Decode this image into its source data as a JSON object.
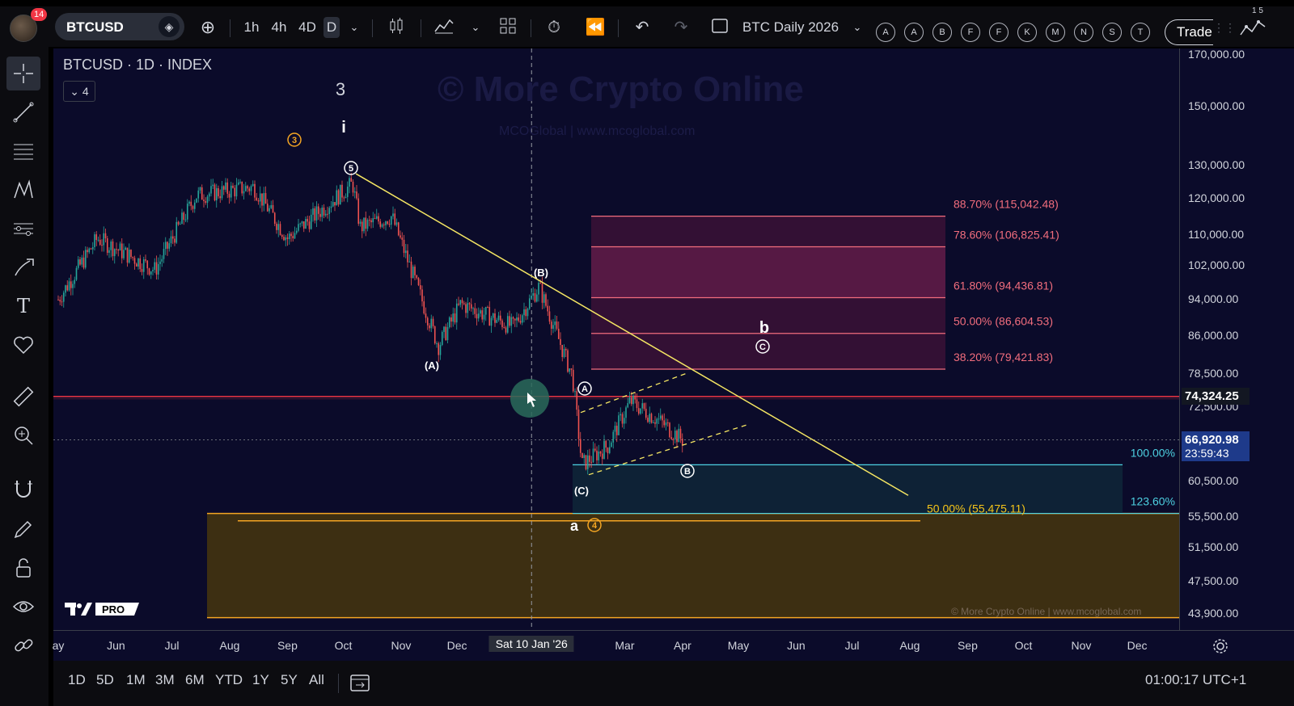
{
  "toolbar": {
    "notification_count": "14",
    "symbol": "BTCUSD",
    "intervals": [
      "1h",
      "4h",
      "4D",
      "D"
    ],
    "active_interval": "D",
    "layout_name": "BTC Daily 2026",
    "alert_letters": [
      "A",
      "A",
      "B",
      "F",
      "F",
      "K",
      "M",
      "N",
      "S",
      "T"
    ],
    "trade_label": "Trade",
    "right_digits": "1 5"
  },
  "chart_header": {
    "legend": "BTCUSD · 1D · INDEX",
    "collapse_count": "4",
    "watermark_main": "© More Crypto Online",
    "watermark_sub": "MCOGlobal  |  www.mcoglobal.com",
    "footer_watermark": "© More Crypto Online  |  www.mcoglobal.com"
  },
  "price_axis": {
    "ticks": [
      "170,000.00",
      "150,000.00",
      "130,000.00",
      "120,000.00",
      "110,000.00",
      "102,000.00",
      "94,000.00",
      "86,000.00",
      "78,500.00",
      "72,500.00",
      "60,500.00",
      "55,500.00",
      "51,500.00",
      "47,500.00",
      "43,900.00"
    ],
    "horizontal_line_price": "74,324.25",
    "last_price": "66,920.98",
    "countdown": "23:59:43"
  },
  "time_axis": {
    "labels": [
      "ay",
      "Jun",
      "Jul",
      "Aug",
      "Sep",
      "Oct",
      "Nov",
      "Dec",
      "Sat 10 Jan '26",
      "Mar",
      "Apr",
      "May",
      "Jun",
      "Jul",
      "Aug",
      "Sep",
      "Oct",
      "Nov",
      "Dec"
    ]
  },
  "bottom_bar": {
    "ranges": [
      "1D",
      "5D",
      "1M",
      "3M",
      "6M",
      "YTD",
      "1Y",
      "5Y",
      "All"
    ],
    "clock": "01:00:17 UTC+1"
  },
  "chart_data": {
    "type": "candlestick",
    "symbol": "BTCUSD",
    "timeframe": "1D",
    "scale": "log",
    "y_ticks": [
      170000,
      150000,
      130000,
      120000,
      110000,
      102000,
      94000,
      86000,
      78500,
      72500,
      60500,
      55500,
      51500,
      47500,
      43900
    ],
    "price_path": {
      "dates": [
        "2025-05-01",
        "2025-05-22",
        "2025-06-22",
        "2025-07-14",
        "2025-08-14",
        "2025-09-01",
        "2025-10-06",
        "2025-10-10",
        "2025-10-27",
        "2025-11-21",
        "2025-12-03",
        "2025-12-31",
        "2026-01-14",
        "2026-02-01",
        "2026-02-06",
        "2026-02-20",
        "2026-03-04",
        "2026-03-20",
        "2026-04-01"
      ],
      "close": [
        94000,
        109000,
        101000,
        121000,
        123500,
        109000,
        124500,
        112000,
        115000,
        84000,
        93000,
        88000,
        97000,
        78000,
        63000,
        66000,
        73500,
        70000,
        66920
      ]
    },
    "fibonacci_retracement": [
      {
        "level": "88.70% (115,042.48)",
        "price": 115042.48
      },
      {
        "level": "78.60% (106,825.41)",
        "price": 106825.41
      },
      {
        "level": "61.80% (94,436.81)",
        "price": 94436.81
      },
      {
        "level": "50.00% (86,604.53)",
        "price": 86604.53
      },
      {
        "level": "38.20% (79,421.83)",
        "price": 79421.83
      }
    ],
    "fibonacci_extension": [
      {
        "level": "100.00%",
        "price": 63000
      },
      {
        "level": "123.60%",
        "price": 56000
      }
    ],
    "support_label": "50.00% (55,475.11)",
    "support_price": 55475.11,
    "support_zone": [
      56000,
      43500
    ],
    "horizontal_line": 74324.25,
    "last_price": 66920.98,
    "wave_labels": [
      "3",
      "i",
      "3",
      "5",
      "(A)",
      "(B)",
      "A",
      "B",
      "C",
      "(C)",
      "a",
      "4",
      "b"
    ]
  }
}
